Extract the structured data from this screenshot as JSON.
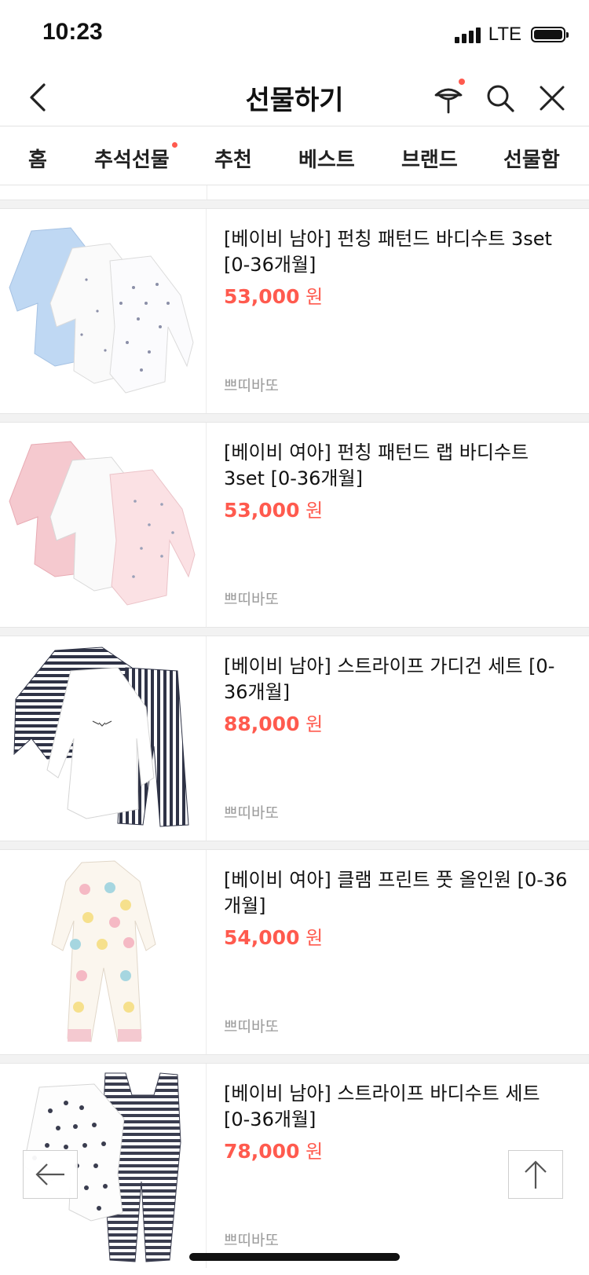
{
  "status": {
    "time": "10:23",
    "network": "LTE"
  },
  "nav": {
    "title": "선물하기",
    "back_icon": "chevron-left-icon",
    "icons": [
      "gift-icon",
      "search-icon",
      "close-icon"
    ]
  },
  "tabs": [
    {
      "label": "홈"
    },
    {
      "label": "추석선물"
    },
    {
      "label": "추천"
    },
    {
      "label": "베스트"
    },
    {
      "label": "브랜드"
    },
    {
      "label": "선물함"
    }
  ],
  "products": [
    {
      "name": "[베이비 남아] 펀칭 패턴드 바디수트 3set [0-36개월]",
      "price": "53,000",
      "currency": "원",
      "brand": "쁘띠바또"
    },
    {
      "name": "[베이비 여아] 펀칭 패턴드 랩 바디수트 3set [0-36개월]",
      "price": "53,000",
      "currency": "원",
      "brand": "쁘띠바또"
    },
    {
      "name": "[베이비 남아] 스트라이프 가디건 세트 [0-36개월]",
      "price": "88,000",
      "currency": "원",
      "brand": "쁘띠바또"
    },
    {
      "name": "[베이비 여아] 클램 프린트 풋 올인원 [0-36개월]",
      "price": "54,000",
      "currency": "원",
      "brand": "쁘띠바또"
    },
    {
      "name": "[베이비 남아] 스트라이프 바디수트 세트 [0-36개월]",
      "price": "78,000",
      "currency": "원",
      "brand": "쁘띠바또"
    }
  ],
  "colors": {
    "accent": "#ff5a4e",
    "divider": "#f2f2f2"
  }
}
